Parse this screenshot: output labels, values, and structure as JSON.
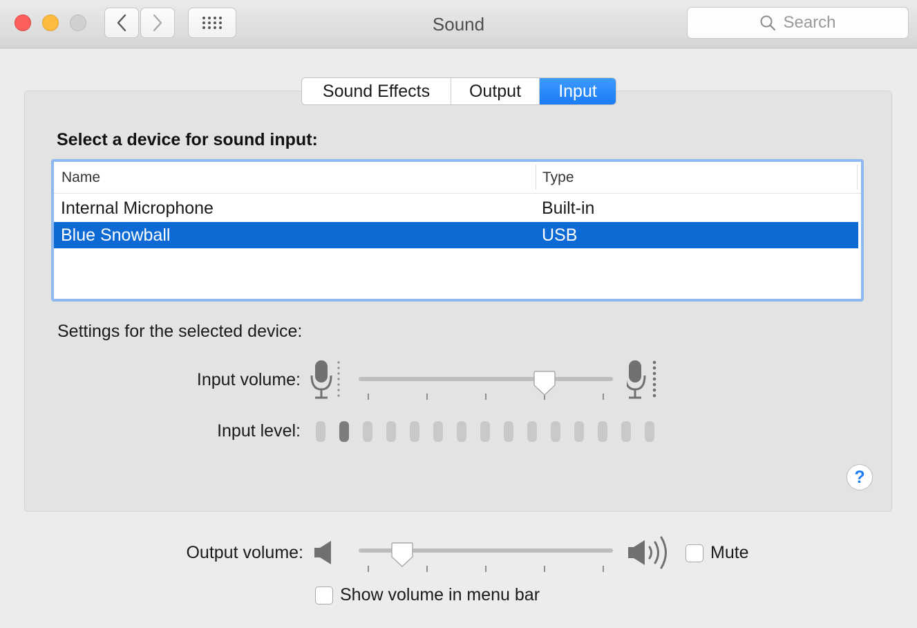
{
  "window": {
    "title": "Sound",
    "search_placeholder": "Search"
  },
  "tabs": [
    {
      "label": "Sound Effects",
      "selected": false
    },
    {
      "label": "Output",
      "selected": false
    },
    {
      "label": "Input",
      "selected": true
    }
  ],
  "input": {
    "heading": "Select a device for sound input:",
    "columns": {
      "name": "Name",
      "type": "Type"
    },
    "devices": [
      {
        "name": "Internal Microphone",
        "type": "Built-in",
        "selected": false
      },
      {
        "name": "Blue Snowball",
        "type": "USB",
        "selected": true
      }
    ],
    "settings_label": "Settings for the selected device:",
    "volume_label": "Input volume:",
    "volume_fraction": 0.73,
    "level_label": "Input level:",
    "level_segments": 15,
    "level_active": [
      1
    ]
  },
  "output": {
    "volume_label": "Output volume:",
    "volume_fraction": 0.17,
    "mute_label": "Mute",
    "mute_checked": false,
    "show_in_menubar_label": "Show volume in menu bar",
    "show_in_menubar_checked": false
  },
  "help_symbol": "?",
  "colors": {
    "accent": "#1a7bf7",
    "selection": "#0d6ad5"
  },
  "icons": [
    "chevron-left-icon",
    "chevron-right-icon",
    "grid-icon",
    "magnifier-icon",
    "microphone-icon",
    "speaker-icon",
    "speaker-loud-icon",
    "help-icon"
  ]
}
